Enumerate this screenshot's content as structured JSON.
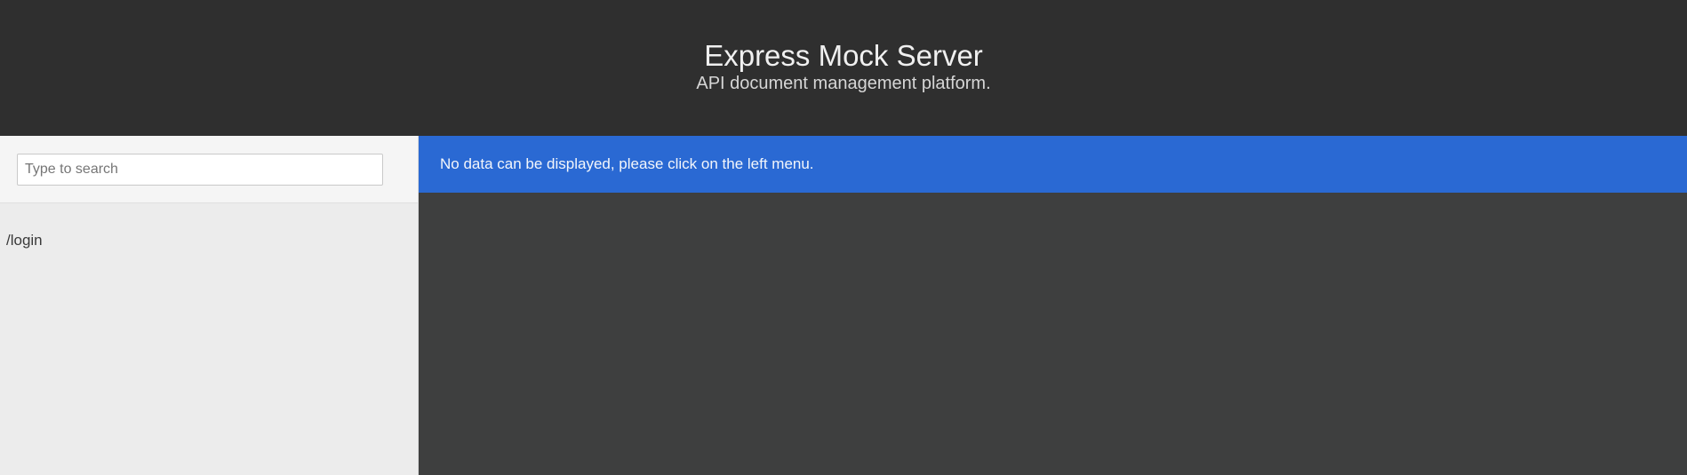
{
  "header": {
    "title": "Express Mock Server",
    "subtitle": "API document management platform."
  },
  "sidebar": {
    "search": {
      "placeholder": "Type to search",
      "value": ""
    },
    "items": [
      {
        "label": "/login"
      }
    ]
  },
  "main": {
    "notice": "No data can be displayed, please click on the left menu."
  },
  "colors": {
    "header_bg": "#2f2f2f",
    "sidebar_bg": "#ececec",
    "main_bg": "#3e3f3f",
    "notice_bg": "#2a69d3"
  }
}
